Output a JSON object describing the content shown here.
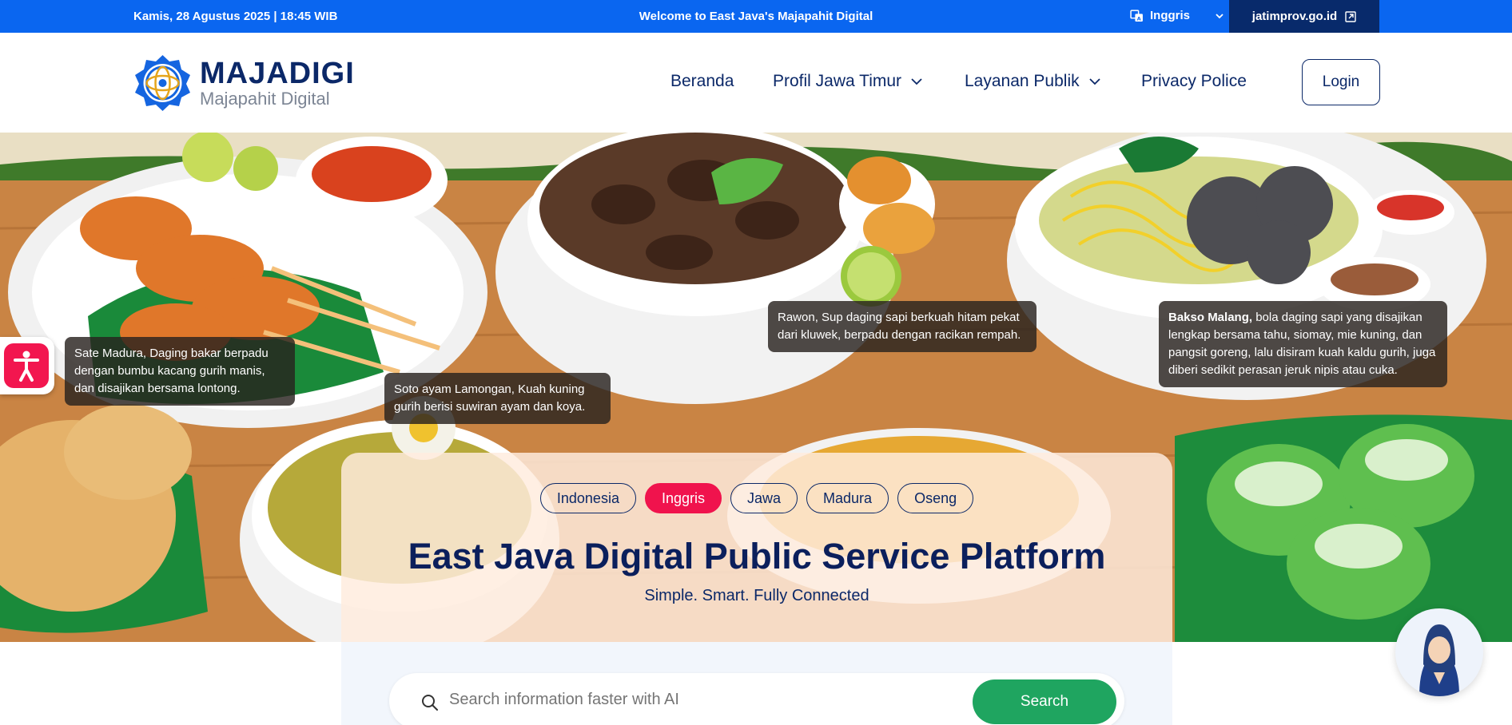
{
  "topbar": {
    "datetime": "Kamis, 28 Agustus 2025 | 18:45 WIB",
    "welcome": "Welcome to East Java's Majapahit Digital",
    "language": "Inggris",
    "site_link": "jatimprov.go.id"
  },
  "brand": {
    "name": "MAJADIGI",
    "tagline": "Majapahit Digital"
  },
  "nav": {
    "home": "Beranda",
    "profile": "Profil Jawa Timur",
    "services": "Layanan Publik",
    "privacy": "Privacy Police",
    "login": "Login"
  },
  "callouts": {
    "sate": "Sate Madura, Daging bakar berpadu dengan bumbu kacang gurih manis, dan disajikan bersama lontong.",
    "soto": "Soto ayam Lamongan, Kuah kuning gurih berisi suwiran ayam dan koya.",
    "rawon": "Rawon, Sup daging sapi berkuah hitam pekat dari kluwek, berpadu dengan racikan rempah.",
    "bakso_title": "Bakso Malang,",
    "bakso_text": " bola daging sapi yang disajikan lengkap bersama tahu, siomay, mie kuning, dan pangsit goreng, lalu disiram kuah kaldu gurih, juga diberi sedikit perasan jeruk nipis atau cuka."
  },
  "language_chips": [
    "Indonesia",
    "Inggris",
    "Jawa",
    "Madura",
    "Oseng"
  ],
  "active_language": "Inggris",
  "hero": {
    "title": "East Java Digital Public Service Platform",
    "subtitle": "Simple. Smart. Fully Connected"
  },
  "search": {
    "placeholder": "Search information faster with AI",
    "button": "Search"
  },
  "colors": {
    "topbar": "#0a66f0",
    "navy": "#0b2868",
    "accent_pink": "#f0134d",
    "search_green": "#1fa560"
  }
}
